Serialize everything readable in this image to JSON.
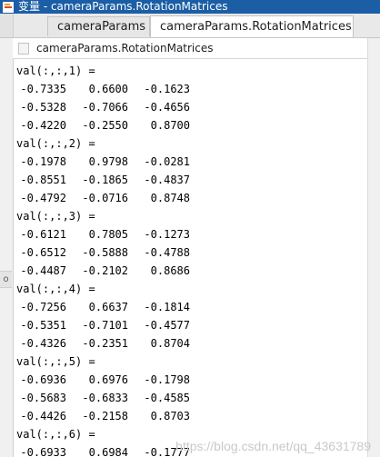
{
  "window": {
    "title": "变量 - cameraParams.RotationMatrices"
  },
  "tabs": [
    {
      "label": "cameraParams",
      "active": false
    },
    {
      "label": "cameraParams.RotationMatrices",
      "active": true
    }
  ],
  "variable": {
    "name": "cameraParams.RotationMatrices"
  },
  "slices": [
    {
      "header": "val(:,:,1) =",
      "rows": [
        [
          "-0.7335",
          "0.6600",
          "-0.1623"
        ],
        [
          "-0.5328",
          "-0.7066",
          "-0.4656"
        ],
        [
          "-0.4220",
          "-0.2550",
          "0.8700"
        ]
      ]
    },
    {
      "header": "val(:,:,2) =",
      "rows": [
        [
          "-0.1978",
          "0.9798",
          "-0.0281"
        ],
        [
          "-0.8551",
          "-0.1865",
          "-0.4837"
        ],
        [
          "-0.4792",
          "-0.0716",
          "0.8748"
        ]
      ]
    },
    {
      "header": "val(:,:,3) =",
      "rows": [
        [
          "-0.6121",
          "0.7805",
          "-0.1273"
        ],
        [
          "-0.6512",
          "-0.5888",
          "-0.4788"
        ],
        [
          "-0.4487",
          "-0.2102",
          "0.8686"
        ]
      ]
    },
    {
      "header": "val(:,:,4) =",
      "rows": [
        [
          "-0.7256",
          "0.6637",
          "-0.1814"
        ],
        [
          "-0.5351",
          "-0.7101",
          "-0.4577"
        ],
        [
          "-0.4326",
          "-0.2351",
          "0.8704"
        ]
      ]
    },
    {
      "header": "val(:,:,5) =",
      "rows": [
        [
          "-0.6936",
          "0.6976",
          "-0.1798"
        ],
        [
          "-0.5683",
          "-0.6833",
          "-0.4585"
        ],
        [
          "-0.4426",
          "-0.2158",
          "0.8703"
        ]
      ]
    },
    {
      "header": "val(:,:,6) =",
      "rows": [
        [
          "-0.6933",
          "0.6984",
          "-0.1777"
        ]
      ]
    }
  ],
  "watermark": "https://blog.csdn.net/qq_43631789",
  "colors": {
    "titlebar": "#1b5ea5",
    "tab_active": "#ffffff",
    "tab_inactive": "#e6e6e6"
  }
}
